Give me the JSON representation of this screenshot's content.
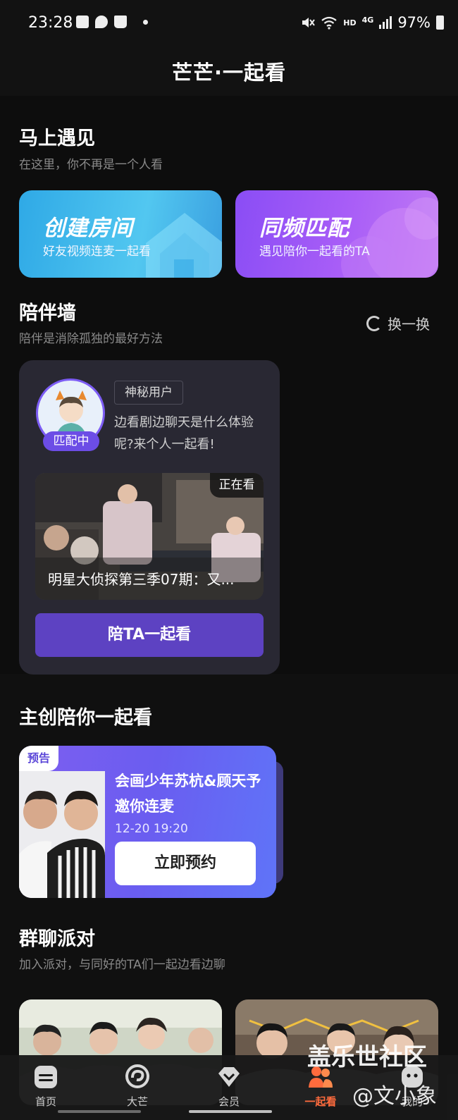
{
  "status_bar": {
    "time": "23:28",
    "battery": "97%",
    "network_hd": "HD",
    "network_type": "4G"
  },
  "header": {
    "title": "芒芒·一起看"
  },
  "meet": {
    "title": "马上遇见",
    "subtitle": "在这里，你不再是一个人看",
    "create_room": {
      "title": "创建房间",
      "subtitle": "好友视频连麦一起看"
    },
    "match": {
      "title": "同频匹配",
      "subtitle": "遇见陪你一起看的TA"
    }
  },
  "wall": {
    "title": "陪伴墙",
    "subtitle": "陪伴是消除孤独的最好方法",
    "refresh_label": "换一换",
    "card": {
      "badge": "匹配中",
      "user_tag": "神秘用户",
      "description": "边看剧边聊天是什么体验呢?来个人一起看!",
      "watching_badge": "正在看",
      "video_title": "明星大侦探第三季07期：又...",
      "button": "陪TA一起看"
    }
  },
  "creator": {
    "title": "主创陪你一起看",
    "card": {
      "tag": "预告",
      "title": "会画少年苏杭&顾天予邀你连麦",
      "time": "12-20 19:20",
      "button": "立即预约"
    }
  },
  "party": {
    "title": "群聊派对",
    "subtitle": "加入派对，与同好的TA们一起边看边聊"
  },
  "nav": [
    {
      "label": "首页"
    },
    {
      "label": "大芒"
    },
    {
      "label": "会员"
    },
    {
      "label": "一起看"
    },
    {
      "label": "我的"
    }
  ],
  "watermark": {
    "line1": "盖乐世社区",
    "line2": "@文小象"
  },
  "colors": {
    "accent": "#6c4de6",
    "nav_active": "#ff6b3d",
    "background": "#101010"
  }
}
